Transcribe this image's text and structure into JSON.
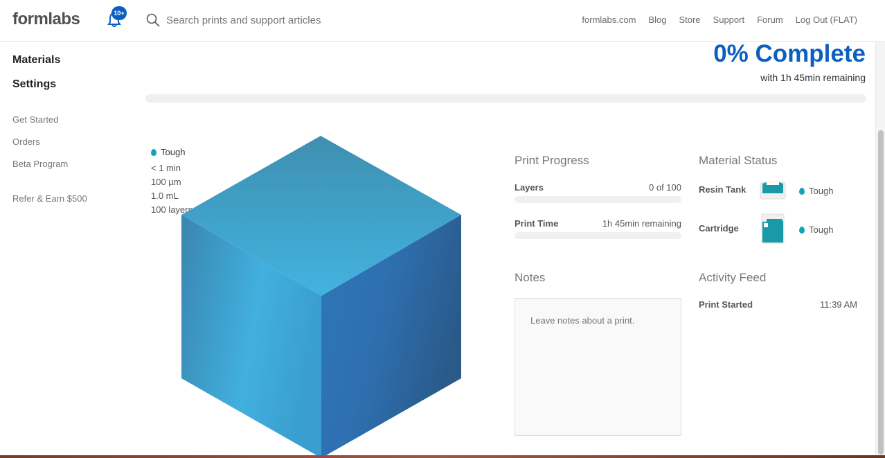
{
  "header": {
    "logo": "formlabs",
    "notification_badge": "10+",
    "search_placeholder": "Search prints and support articles",
    "nav": [
      "formlabs.com",
      "Blog",
      "Store",
      "Support",
      "Forum",
      "Log Out (FLAT)"
    ]
  },
  "sidebar": {
    "primary": [
      "Materials",
      "Settings"
    ],
    "secondary": [
      "Get Started",
      "Orders",
      "Beta Program",
      "Refer & Earn $500"
    ]
  },
  "progress": {
    "complete_label": "0% Complete",
    "remaining_label": "with 1h 45min remaining",
    "percent": 0
  },
  "part": {
    "material": "Tough",
    "specs": [
      "< 1 min",
      "100 µm",
      "1.0 mL",
      "100 layers"
    ]
  },
  "print_progress": {
    "title": "Print Progress",
    "layers_label": "Layers",
    "layers_value": "0 of 100",
    "layers_fraction": 0,
    "time_label": "Print Time",
    "time_value": "1h 45min remaining",
    "time_fraction": 0
  },
  "material_status": {
    "title": "Material Status",
    "tank_label": "Resin Tank",
    "tank_material": "Tough",
    "cartridge_label": "Cartridge",
    "cartridge_material": "Tough"
  },
  "notes": {
    "title": "Notes",
    "placeholder": "Leave notes about a print."
  },
  "activity": {
    "title": "Activity Feed",
    "items": [
      {
        "event": "Print Started",
        "time": "11:39 AM"
      }
    ]
  },
  "colors": {
    "accent": "#0b5fbf",
    "resin": "#17a2b8"
  }
}
